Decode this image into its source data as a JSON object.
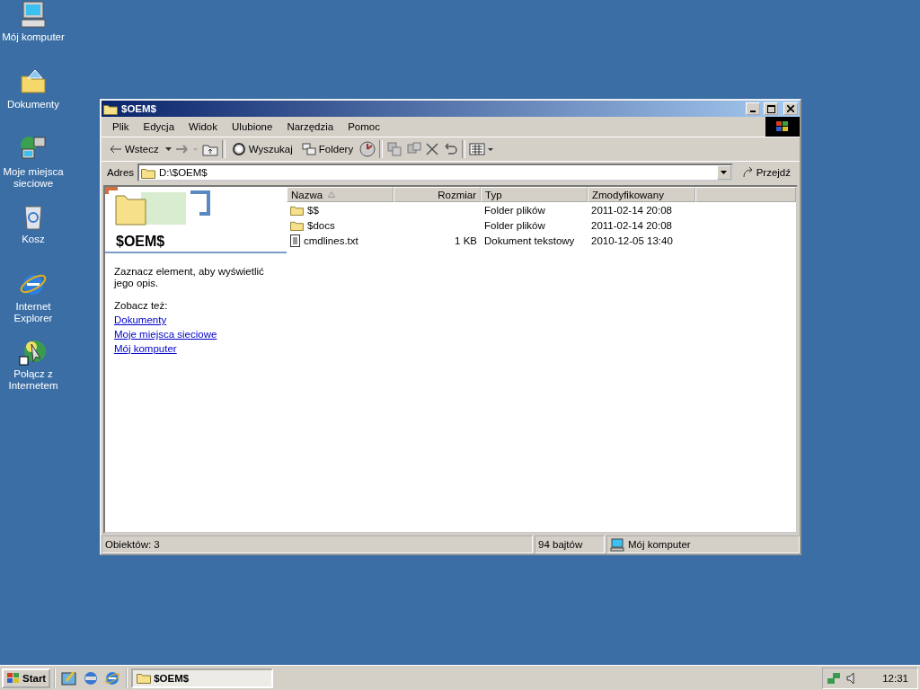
{
  "desktop_icons": [
    {
      "kind": "computer",
      "label": "Mój komputer"
    },
    {
      "kind": "documents",
      "label": "Dokumenty"
    },
    {
      "kind": "network",
      "label": "Moje miejsca sieciowe"
    },
    {
      "kind": "recycle",
      "label": "Kosz"
    },
    {
      "kind": "browser",
      "label": "Internet Explorer"
    },
    {
      "kind": "connect",
      "label": "Połącz z Internetem"
    }
  ],
  "window": {
    "title": "$OEM$",
    "menu": [
      "Plik",
      "Edycja",
      "Widok",
      "Ulubione",
      "Narzędzia",
      "Pomoc"
    ],
    "toolbar": [
      {
        "kind": "back",
        "label": "Wstecz"
      },
      {
        "kind": "forward"
      },
      {
        "kind": "up"
      },
      {
        "kind": "search",
        "label": "Wyszukaj"
      },
      {
        "kind": "folders",
        "label": "Foldery"
      },
      {
        "kind": "history"
      },
      {
        "kind": "move"
      },
      {
        "kind": "copy"
      },
      {
        "kind": "delete"
      },
      {
        "kind": "undo"
      },
      {
        "kind": "views"
      }
    ],
    "address": {
      "label": "Adres",
      "value": "D:\\$OEM$",
      "go": "Przejdź"
    },
    "panel": {
      "title": "$OEM$",
      "description": "Zaznacz element, aby wyświetlić jego opis.",
      "see_also": "Zobacz też:",
      "links": [
        "Dokumenty",
        "Moje miejsca sieciowe",
        "Mój komputer"
      ]
    },
    "columns": [
      "Nazwa",
      "Rozmiar",
      "Typ",
      "Zmodyfikowany"
    ],
    "rows": [
      {
        "kind": "folder",
        "name": "$$",
        "type": "Folder plików",
        "modified": "2011-02-14 20:08"
      },
      {
        "kind": "folder",
        "name": "$docs",
        "type": "Folder plików",
        "modified": "2011-02-14 20:08"
      },
      {
        "kind": "text",
        "name": "cmdlines.txt",
        "size": "1 KB",
        "type": "Dokument tekstowy",
        "modified": "2010-12-05 13:40"
      }
    ],
    "status": {
      "objects": "Obiektów: 3",
      "size": "94 bajtów",
      "zone": "Mój komputer"
    }
  },
  "taskbar": {
    "start": "Start",
    "quick_launch": [
      {
        "kind": "desktop"
      },
      {
        "kind": "channels"
      },
      {
        "kind": "browser"
      }
    ],
    "tasks": [
      {
        "title": "$OEM$",
        "selected": true
      }
    ],
    "clock": "12:31"
  }
}
